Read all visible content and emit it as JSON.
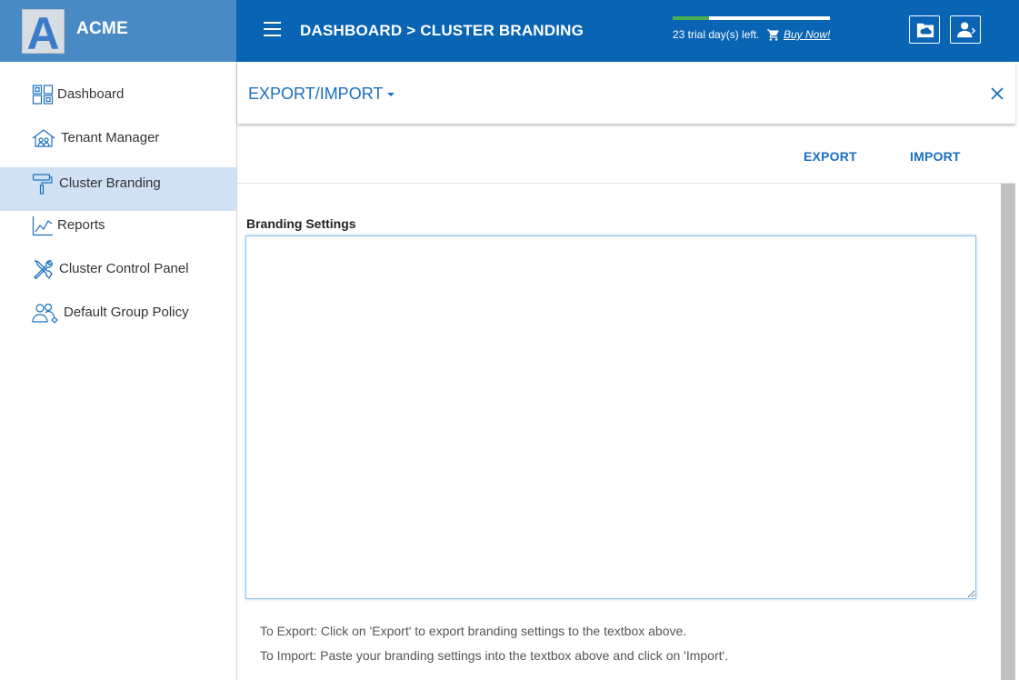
{
  "brand": {
    "logo_letter": "A",
    "name": "ACME"
  },
  "header": {
    "breadcrumb": "DASHBOARD > CLUSTER BRANDING",
    "trial_text": "23 trial day(s) left.",
    "trial_progress": 0.23,
    "buy_link": "Buy Now!"
  },
  "sidebar": {
    "items": [
      {
        "label": "Dashboard",
        "icon": "dashboard-icon"
      },
      {
        "label": "Tenant Manager",
        "icon": "tenant-manager-icon"
      },
      {
        "label": "Cluster Branding",
        "icon": "paint-roller-icon",
        "active": true
      },
      {
        "label": "Reports",
        "icon": "reports-chart-icon"
      },
      {
        "label": "Cluster Control Panel",
        "icon": "tools-icon"
      },
      {
        "label": "Default Group Policy",
        "icon": "group-policy-icon"
      }
    ]
  },
  "section": {
    "title": "EXPORT/IMPORT"
  },
  "actions": {
    "export_label": "EXPORT",
    "import_label": "IMPORT"
  },
  "form": {
    "label": "Branding Settings",
    "value": "",
    "hint_export": "To Export: Click on 'Export' to export branding settings to the textbox above.",
    "hint_import": "To Import: Paste your branding settings into the textbox above and click on 'Import'."
  },
  "colors": {
    "header": "#0a64b4",
    "brand_panel": "#4a8ac4",
    "accent": "#1a6fbf",
    "active_nav": "#cfe1f2",
    "progress": "#4caf50"
  }
}
